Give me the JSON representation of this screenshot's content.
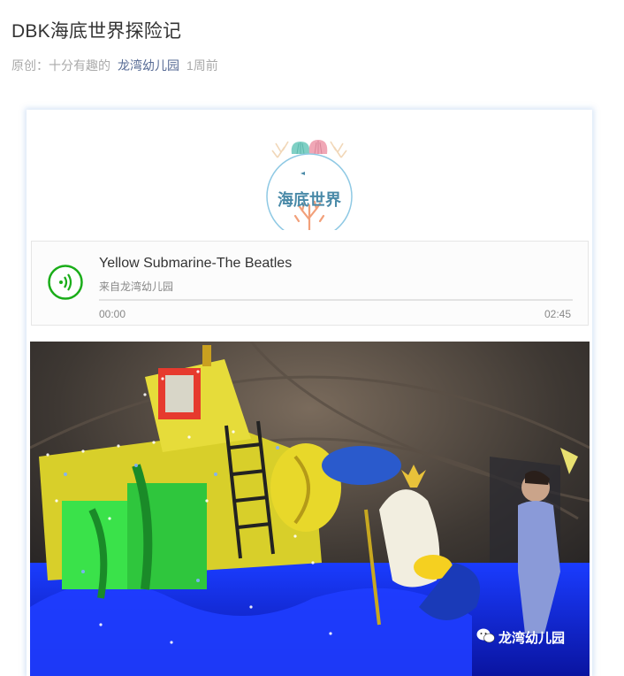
{
  "article": {
    "title": "DBK海底世界探险记",
    "meta_original": "原创：十分有趣的",
    "meta_account": "龙湾幼儿园",
    "meta_time": "1周前"
  },
  "logo": {
    "text": "海底世界",
    "icon": "seashell-coral-logo"
  },
  "audio": {
    "title": "Yellow Submarine-The Beatles",
    "from": "来自龙湾幼儿园",
    "current_time": "00:00",
    "duration": "02:45",
    "progress": 0,
    "play_icon": "audio-play-icon",
    "accent": "#1aad19"
  },
  "photo": {
    "watermark": "龙湾幼儿园",
    "watermark_icon": "wechat-icon"
  }
}
